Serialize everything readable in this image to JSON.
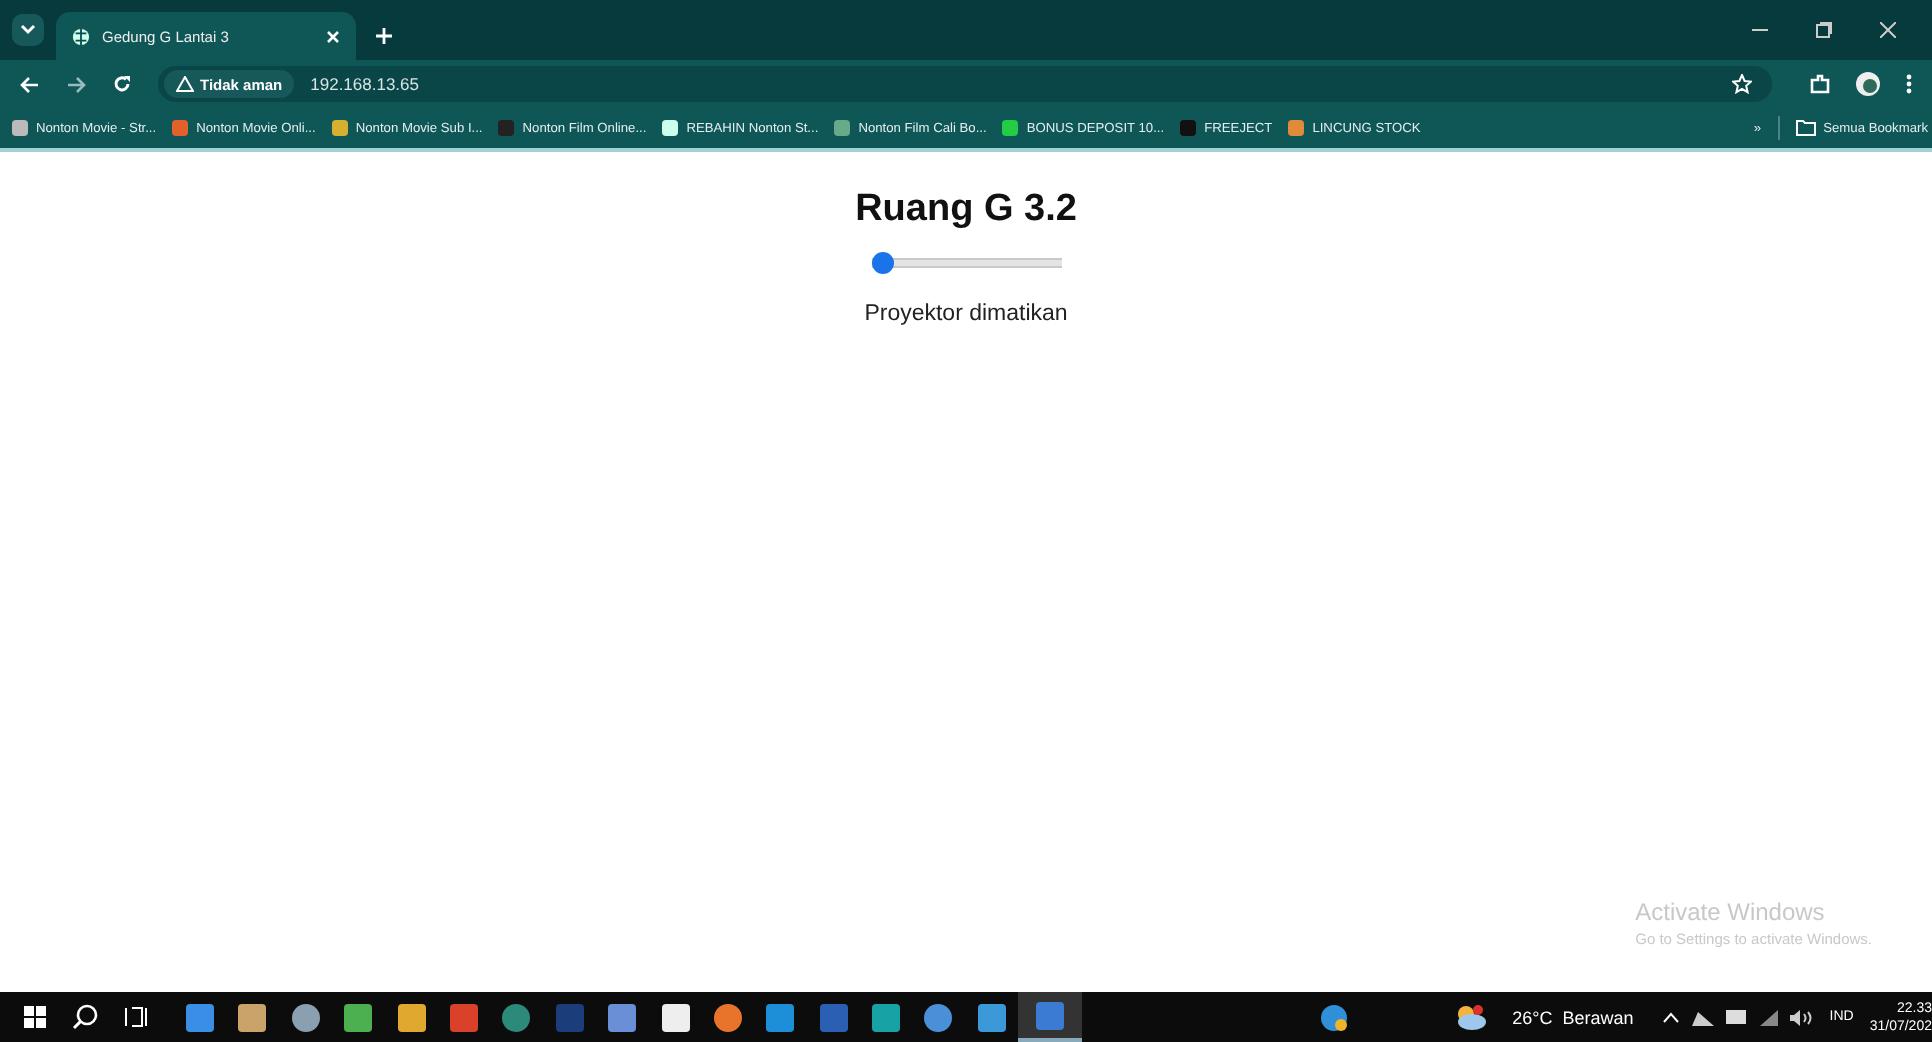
{
  "browser": {
    "tab": {
      "title": "Gedung G Lantai 3",
      "selected": true
    },
    "address": {
      "security": "Tidak aman",
      "url": "192.168.13.65"
    },
    "bookmarks": [
      {
        "label": "Nonton Movie - Str..."
      },
      {
        "label": "Nonton Movie Onli..."
      },
      {
        "label": "Nonton Movie Sub I..."
      },
      {
        "label": "Nonton Film Online..."
      },
      {
        "label": "REBAHIN Nonton St..."
      },
      {
        "label": "Nonton Film Cali Bo..."
      },
      {
        "label": "BONUS DEPOSIT 10..."
      },
      {
        "label": "FREEJECT"
      },
      {
        "label": "LINCUNG STOCK"
      }
    ],
    "more": "»",
    "all_bookmarks": "Semua Bookmark"
  },
  "page": {
    "title": "Ruang G 3.2",
    "slider": {
      "level": 0
    },
    "status": "Proyektor dimatikan"
  },
  "activation": {
    "title": "Activate Windows",
    "hint": "Go to Settings to activate Windows."
  },
  "taskbar": {
    "apps": [
      {
        "selected": false
      },
      {
        "selected": false
      },
      {
        "selected": false
      },
      {
        "selected": false
      },
      {
        "selected": false
      },
      {
        "selected": false
      },
      {
        "selected": false
      },
      {
        "selected": false
      },
      {
        "selected": false
      },
      {
        "selected": false
      },
      {
        "selected": false
      },
      {
        "selected": false
      },
      {
        "selected": false
      },
      {
        "selected": false
      },
      {
        "selected": false
      },
      {
        "selected": false
      },
      {
        "selected": true
      }
    ],
    "weather": "26°C  Berawan",
    "language": "IND",
    "time": "22.33",
    "date": "31/07/202"
  }
}
